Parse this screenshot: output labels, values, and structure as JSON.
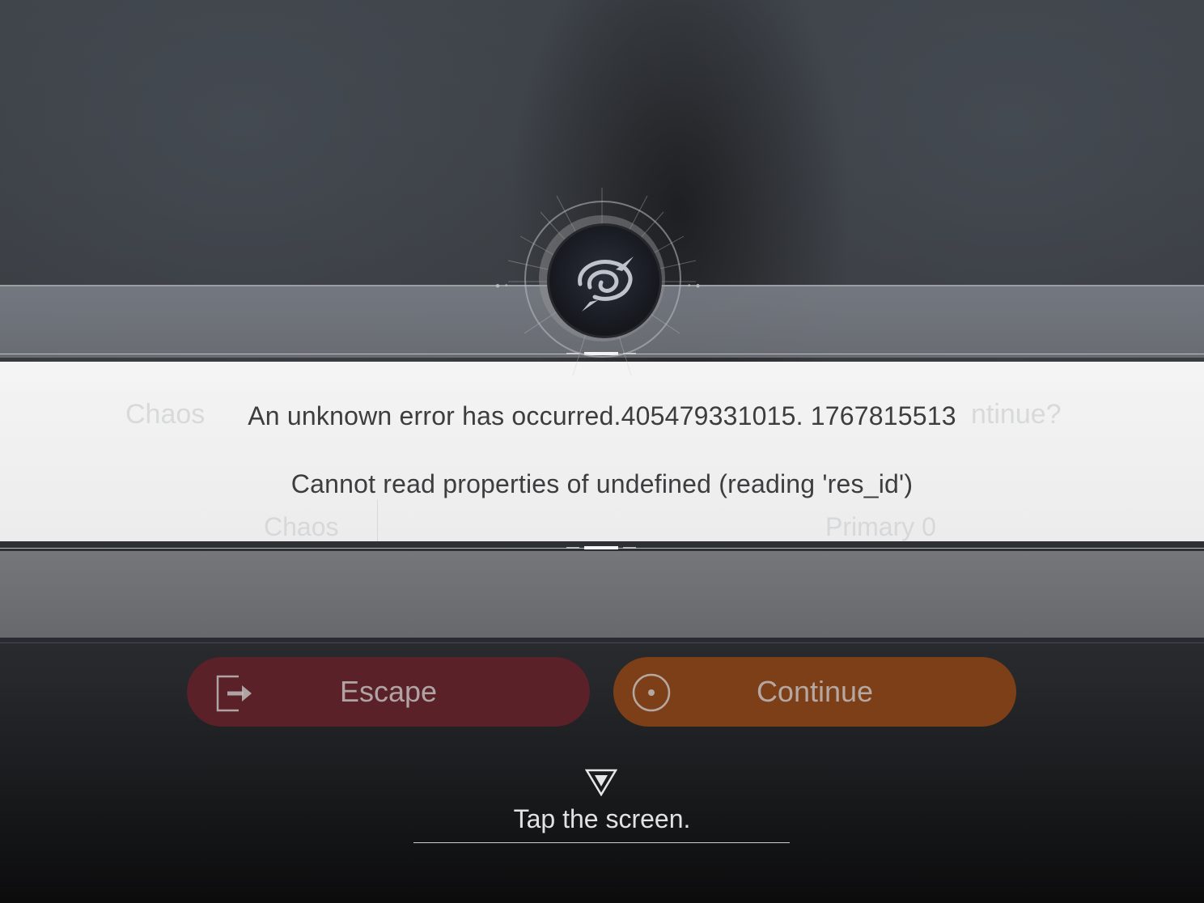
{
  "dialog": {
    "error_line1": "An unknown error has occurred.405479331015. 1767815513",
    "error_line2": "Cannot read properties of undefined (reading 'res_id')",
    "background_question_left": "Chaos",
    "background_question_right": "ntinue?",
    "background_row_left": "Chaos",
    "background_row_right": "Primary 0"
  },
  "buttons": {
    "escape_label": "Escape",
    "continue_label": "Continue",
    "escape_icon": "exit-door-icon",
    "continue_icon": "target-circle-icon"
  },
  "footer": {
    "prompt": "Tap the screen.",
    "icon": "down-triangle-icon"
  },
  "emblem": {
    "icon": "swirl-logo-icon"
  },
  "colors": {
    "escape_bg": "#5a2128",
    "continue_bg": "#7d3f18",
    "panel_bg": "#f0f0f0",
    "text_dark": "#3d3d3f"
  }
}
